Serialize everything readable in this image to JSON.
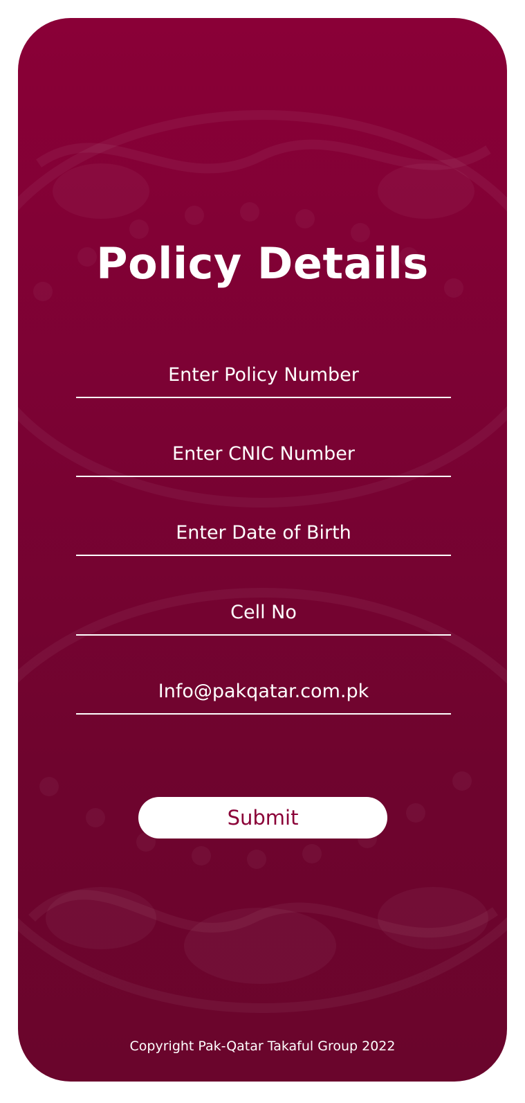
{
  "page": {
    "title": "Policy Details",
    "copyright": "Copyright Pak-Qatar Takaful Group 2022"
  },
  "form": {
    "fields": [
      {
        "name": "policy-number-input",
        "placeholder": "Enter Policy Number",
        "value": ""
      },
      {
        "name": "cnic-number-input",
        "placeholder": "Enter CNIC Number",
        "value": ""
      },
      {
        "name": "date-of-birth-input",
        "placeholder": "Enter Date of Birth",
        "value": ""
      },
      {
        "name": "cell-number-input",
        "placeholder": "Cell No",
        "value": ""
      },
      {
        "name": "email-input",
        "placeholder": "Info@pakqatar.com.pk",
        "value": ""
      }
    ],
    "submit_label": "Submit"
  },
  "colors": {
    "background_top": "#8a0037",
    "background_bottom": "#6a052c",
    "text": "#ffffff",
    "button_text": "#8a0037"
  }
}
